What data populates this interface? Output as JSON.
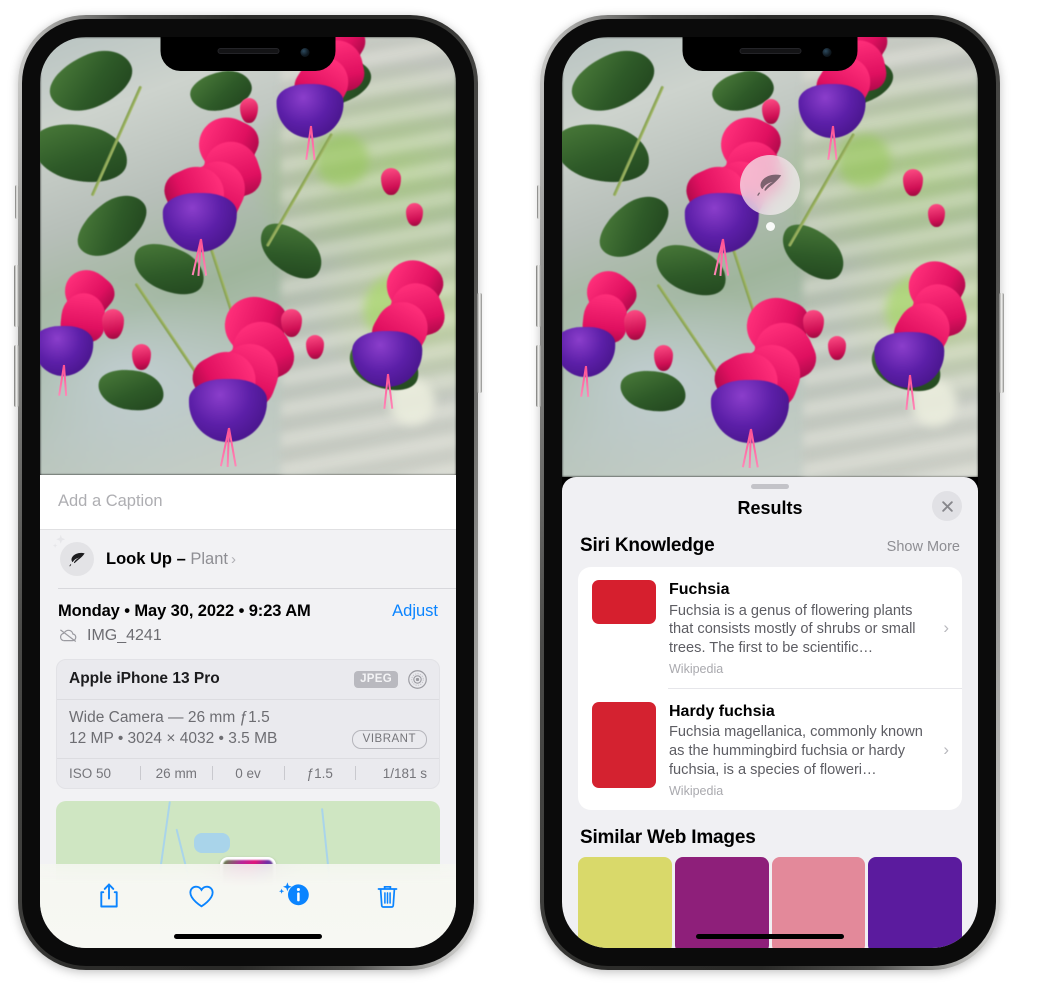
{
  "left_phone": {
    "name": "iPhone 13 Pro — Photos app, photo info sheet",
    "caption_placeholder": "Add a Caption",
    "lookup": {
      "icon": "leaf-icon",
      "sparkle_icon": "sparkle-icon",
      "label": "Look Up",
      "dash": "–",
      "subject": "Plant",
      "chevron": "›"
    },
    "meta": {
      "date": "Monday • May 30, 2022 • 9:23 AM",
      "adjust_label": "Adjust",
      "cloud_icon": "cloud-slash-icon",
      "filename": "IMG_4241"
    },
    "exif": {
      "device": "Apple iPhone 13 Pro",
      "format_badge": "JPEG",
      "lens_icon": "aperture-icon",
      "lens_line": "Wide Camera — 26 mm ƒ1.5",
      "size_line": "12 MP • 3024 × 4032 • 3.5 MB",
      "vibrant_badge": "VIBRANT",
      "stats": [
        "ISO 50",
        "26 mm",
        "0 ev",
        "ƒ1.5",
        "1/181 s"
      ]
    },
    "toolbar": [
      {
        "name": "share-button",
        "icon": "share-icon"
      },
      {
        "name": "favorite-button",
        "icon": "heart-icon"
      },
      {
        "name": "info-button",
        "icon": "info-sparkle-icon"
      },
      {
        "name": "delete-button",
        "icon": "trash-icon"
      }
    ]
  },
  "right_phone": {
    "name": "iPhone 13 Pro — Visual Look Up results",
    "photo_badge_icon": "leaf-icon",
    "sheet": {
      "grabber": "grabber-handle",
      "title": "Results",
      "close_icon": "close-icon"
    },
    "siri_knowledge": {
      "title": "Siri Knowledge",
      "show_more": "Show More",
      "items": [
        {
          "title": "Fuchsia",
          "description": "Fuchsia is a genus of flowering plants that consists mostly of shrubs or small trees. The first to be scientific…",
          "source": "Wikipedia",
          "chevron": "›"
        },
        {
          "title": "Hardy fuchsia",
          "description": "Fuchsia magellanica, commonly known as the hummingbird fuchsia or hardy fuchsia, is a species of floweri…",
          "source": "Wikipedia",
          "chevron": "›"
        }
      ]
    },
    "similar_web_images": {
      "title": "Similar Web Images",
      "count": 4
    }
  },
  "colors": {
    "accent_blue": "#0a84ff",
    "sheet_bg": "#f2f2f4",
    "results_bg": "#f0f0f3",
    "card_bg": "#ffffff",
    "muted_text": "#8e8e93",
    "flower_pink": "#e01060",
    "flower_purple": "#5c1fa8",
    "leaf_green": "#2e5a28"
  }
}
